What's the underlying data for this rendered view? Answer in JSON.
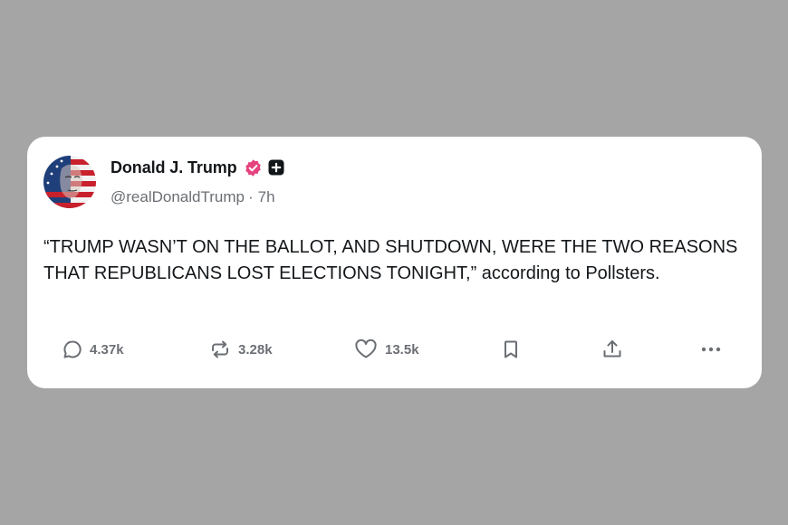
{
  "post": {
    "author": {
      "display_name": "Donald J. Trump",
      "handle": "@realDonaldTrump",
      "separator": "·",
      "time": "7h",
      "verified_icon": "verified-badge-icon",
      "badge_icon": "plus-badge-icon",
      "avatar": "american-flag-portrait-avatar"
    },
    "text": "“TRUMP WASN’T ON THE BALLOT, AND SHUTDOWN, WERE THE TWO REASONS THAT REPUBLICANS LOST ELECTIONS TONIGHT,” according to Pollsters.",
    "actions": {
      "replies": "4.37k",
      "reposts": "3.28k",
      "likes": "13.5k"
    }
  },
  "colors": {
    "background": "#a5a5a5",
    "card": "#ffffff",
    "verified": "#e5437f",
    "text": "#14171a",
    "muted": "#6b6f74"
  }
}
